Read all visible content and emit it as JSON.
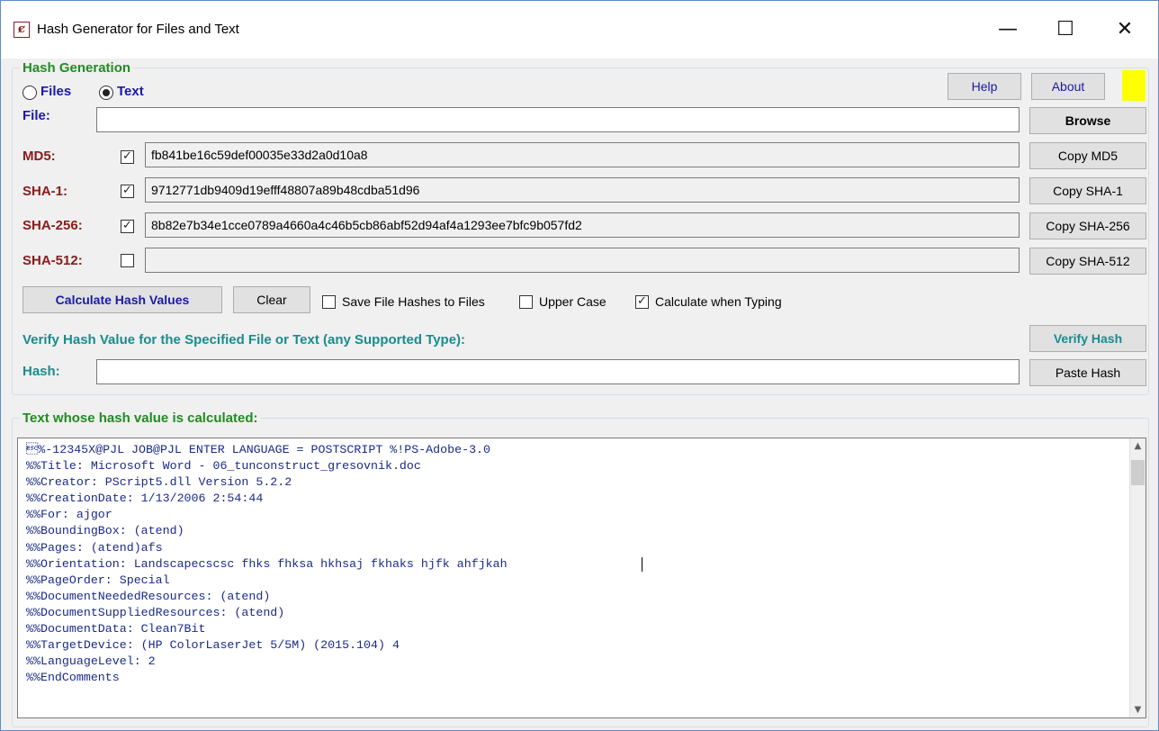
{
  "window": {
    "title": "Hash Generator for Files and Text",
    "app_icon": "ȼ",
    "minimize": "—",
    "maximize": "☐",
    "close": "✕"
  },
  "hash_generation": {
    "group_title": "Hash Generation",
    "mode_options": [
      {
        "label": "Files",
        "selected": false
      },
      {
        "label": "Text",
        "selected": true
      }
    ],
    "help_label": "Help",
    "about_label": "About",
    "indicator_color": "#ffff00",
    "file_label": "File:",
    "file_value": "",
    "browse_label": "Browse",
    "hashes": [
      {
        "label": "MD5:",
        "checked": true,
        "value": "fb841be16c59def00035e33d2a0d10a8",
        "copy_label": "Copy MD5"
      },
      {
        "label": "SHA-1:",
        "checked": true,
        "value": "9712771db9409d19efff48807a89b48cdba51d96",
        "copy_label": "Copy SHA-1"
      },
      {
        "label": "SHA-256:",
        "checked": true,
        "value": "8b82e7b34e1cce0789a4660a4c46b5cb86abf52d94af4a1293ee7bfc9b057fd2",
        "copy_label": "Copy SHA-256"
      },
      {
        "label": "SHA-512:",
        "checked": false,
        "value": "",
        "copy_label": "Copy SHA-512"
      }
    ],
    "calculate_label": "Calculate Hash Values",
    "clear_label": "Clear",
    "options": [
      {
        "label": "Save File Hashes to Files",
        "checked": false
      },
      {
        "label": "Upper Case",
        "checked": false
      },
      {
        "label": "Calculate when Typing",
        "checked": true
      }
    ],
    "verify_heading": "Verify Hash Value for the Specified File or Text (any Supported Type):",
    "verify_label": "Verify Hash",
    "hash_label": "Hash:",
    "hash_value": "",
    "paste_label": "Paste Hash"
  },
  "text_section": {
    "group_title": "Text whose hash value is calculated:",
    "lines": [
      "\u001b%-12345X@PJL JOB@PJL ENTER LANGUAGE = POSTSCRIPT %!PS-Adobe-3.0",
      "%%Title: Microsoft Word - 06_tunconstruct_gresovnik.doc",
      "%%Creator: PScript5.dll Version 5.2.2",
      "%%CreationDate: 1/13/2006 2:54:44",
      "%%For: ajgor",
      "%%BoundingBox: (atend)",
      "%%Pages: (atend)afs",
      "%%Orientation: Landscapecscsc fhks fhksa hkhsaj fkhaks hjfk ahfjkah",
      "%%PageOrder: Special",
      "%%DocumentNeededResources: (atend)",
      "%%DocumentSuppliedResources: (atend)",
      "%%DocumentData: Clean7Bit",
      "%%TargetDevice: (HP ColorLaserJet 5/5M) (2015.104) 4",
      "%%LanguageLevel: 2",
      "%%EndComments"
    ],
    "scroll_up": "▲",
    "scroll_down": "▼"
  }
}
